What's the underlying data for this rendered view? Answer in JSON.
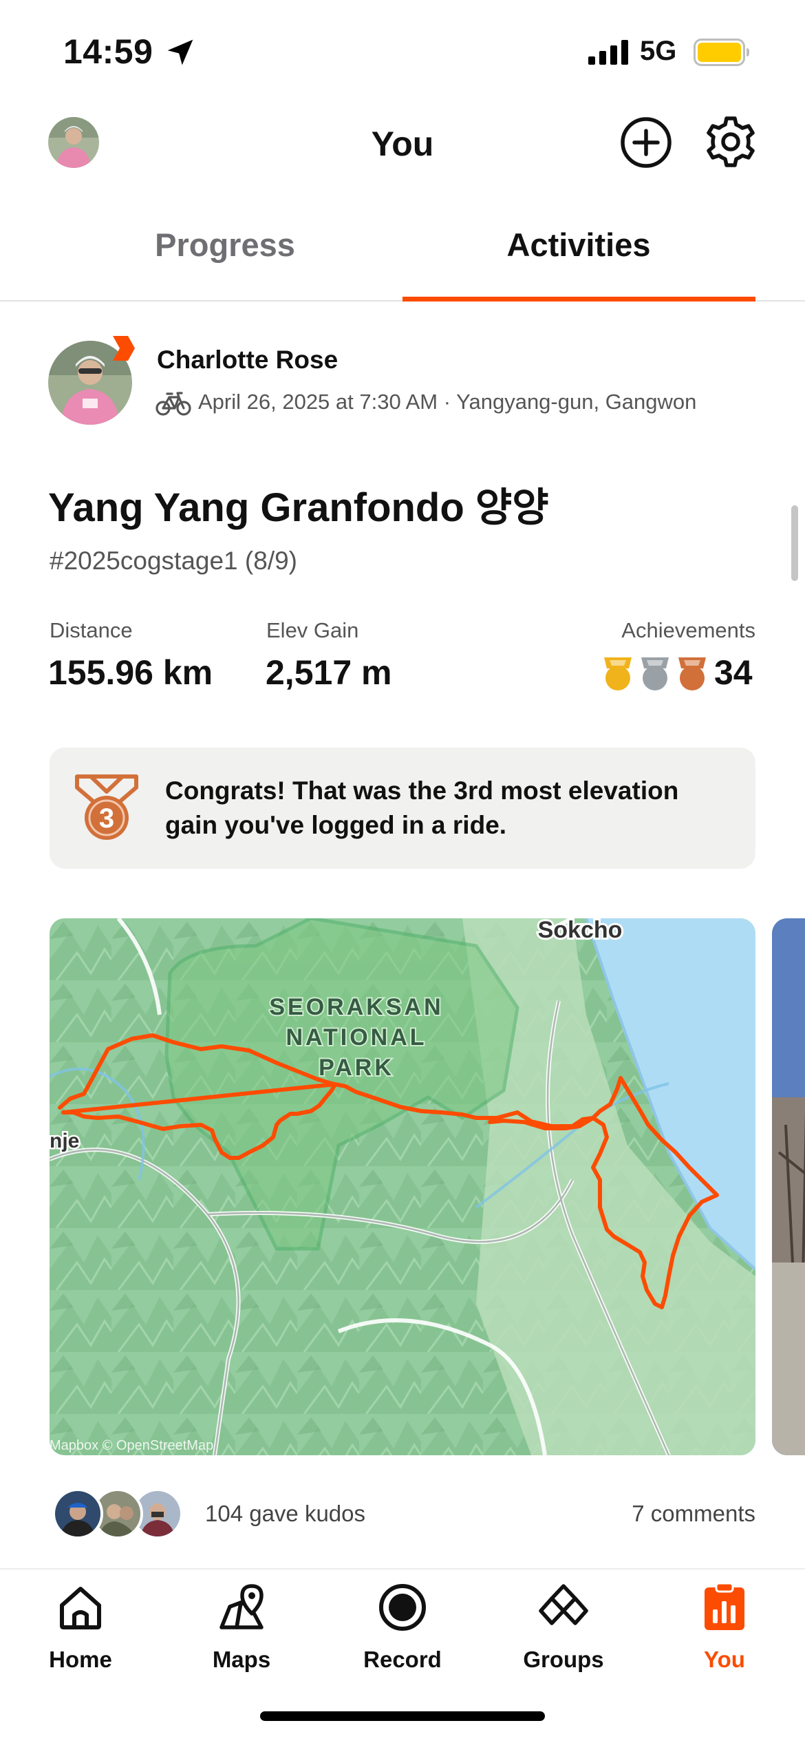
{
  "status_bar": {
    "time": "14:59",
    "network": "5G",
    "battery_color": "#ffcc00"
  },
  "header": {
    "title": "You",
    "add_icon": "plus-circle-icon",
    "settings_icon": "gear-icon"
  },
  "tabs": [
    {
      "label": "Progress",
      "active": false
    },
    {
      "label": "Activities",
      "active": true
    }
  ],
  "activity": {
    "athlete_name": "Charlotte Rose",
    "sport_icon": "bike-icon",
    "meta": "April 26, 2025 at 7:30 AM · Yangyang-gun, Gangwon",
    "title": "Yang Yang Granfondo 양양",
    "description": "#2025cogstage1 (8/9)",
    "stats": {
      "distance_label": "Distance",
      "distance_value": "155.96 km",
      "elev_label": "Elev Gain",
      "elev_value": "2,517 m",
      "achievements_label": "Achievements",
      "achievements_count": "34",
      "medal_colors": [
        "#f0b31b",
        "#9aa1a6",
        "#d2703a"
      ]
    },
    "congrats": {
      "medal_number": "3",
      "text": "Congrats! That was the 3rd most elevation gain you've logged in a ride."
    },
    "map": {
      "place_city": "Sokcho",
      "park_line1": "SEORAKSAN",
      "park_line2": "NATIONAL",
      "park_line3": "PARK",
      "edge_label": "nje",
      "attribution": "Mapbox © OpenStreetMap",
      "route_color": "#fc4c02"
    },
    "kudos_text": "104 gave kudos",
    "comments_text": "7 comments"
  },
  "bottom_nav": [
    {
      "label": "Home",
      "icon": "home-icon",
      "active": false
    },
    {
      "label": "Maps",
      "icon": "maps-icon",
      "active": false
    },
    {
      "label": "Record",
      "icon": "record-icon",
      "active": false
    },
    {
      "label": "Groups",
      "icon": "groups-icon",
      "active": false
    },
    {
      "label": "You",
      "icon": "you-chart-icon",
      "active": true
    }
  ],
  "colors": {
    "accent": "#fc4c02",
    "secondary_text": "#555555",
    "card_bg": "#f1f1ef"
  }
}
